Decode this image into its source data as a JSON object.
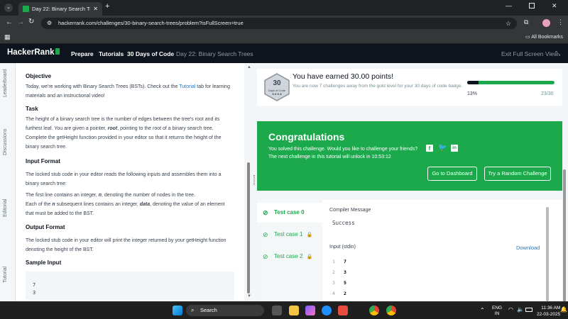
{
  "browser": {
    "tab_title": "Day 22: Binary Search Trees | H",
    "url": "hackerrank.com/challenges/30-binary-search-trees/problem?isFullScreen=true",
    "all_bookmarks": "All Bookmarks"
  },
  "nav": {
    "brand": "HackerRank",
    "items": [
      "Prepare",
      "Tutorials",
      "30 Days of Code",
      "Day 22: Binary Search Trees"
    ],
    "exit_fullscreen": "Exit Full Screen View"
  },
  "side_tabs": [
    "Leaderboard",
    "Discussions",
    "Editorial",
    "Tutorial"
  ],
  "problem": {
    "objective_title": "Objective",
    "objective_text_1": "Today, we're working with Binary Search Trees (BSTs). Check out the ",
    "objective_link": "Tutorial",
    "objective_text_2": " tab for learning materials and an instructional video!",
    "task_title": "Task",
    "task_text_1": "The height of a binary search tree is the number of edges between the tree's root and its furthest leaf. You are given a pointer, ",
    "task_var": "root",
    "task_text_2": ", pointing to the root of a binary search tree. Complete the getHeight function provided in your editor so that it returns the height of the binary search tree.",
    "input_title": "Input Format",
    "input_text_1": "The locked stub code in your editor reads the following inputs and assembles them into a binary search tree:",
    "input_text_2a": "The first line contains an integer, ",
    "input_var_n": "n",
    "input_text_2b": ", denoting the number of nodes in the tree.",
    "input_text_3a": "Each of the ",
    "input_text_3b": " subsequent lines contains an integer, ",
    "input_var_data": "data",
    "input_text_3c": ", denoting the value of an element that must be added to the BST.",
    "output_title": "Output Format",
    "output_text": "The locked stub code in your editor will print the integer returned by your getHeight function denoting the height of the BST.",
    "sample_title": "Sample Input",
    "sample_lines": [
      "7",
      "3"
    ]
  },
  "points": {
    "badge_num": "30",
    "badge_label": "Days of Code",
    "headline": "You have earned 30.00 points!",
    "subtext": "You are now 7 challenges away from the gold level for your 30 days of code badge.",
    "progress_pct": "13%",
    "progress_count": "23/30",
    "progress_value": 13
  },
  "congrats": {
    "title": "Congratulations",
    "line1": "You solved this challenge. Would you like to challenge your friends?",
    "line2": "The next challenge in this tutorial will unlock in 10:53:12",
    "btn_dashboard": "Go to Dashboard",
    "btn_random": "Try a Random Challenge"
  },
  "tests": {
    "cases": [
      "Test case 0",
      "Test case 1",
      "Test case 2"
    ],
    "compiler_label": "Compiler Message",
    "compiler_value": "Success",
    "input_label": "Input (stdin)",
    "download": "Download",
    "input_lines": [
      {
        "n": "1",
        "v": "7"
      },
      {
        "n": "2",
        "v": "3"
      },
      {
        "n": "3",
        "v": "5"
      },
      {
        "n": "4",
        "v": "2"
      }
    ]
  },
  "taskbar": {
    "search": "Search",
    "lang1": "ENG",
    "lang2": "IN",
    "time": "11:36 AM",
    "date": "22-03-2025"
  },
  "colors": {
    "hr_green": "#1ba94c",
    "nav_dark": "#0e141e",
    "link_blue": "#1c76c2"
  }
}
